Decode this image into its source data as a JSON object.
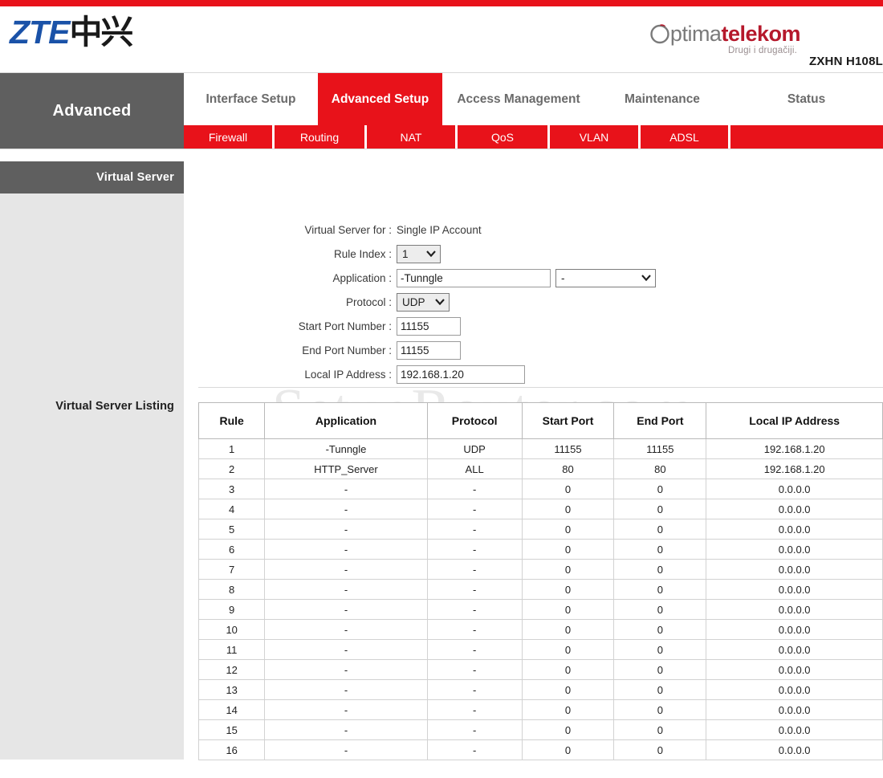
{
  "branding": {
    "zte_latin": "ZTE",
    "zte_cjk": "中兴",
    "optima_o": "O",
    "optima_ptima": "ptima",
    "optima_telekom": "telekom",
    "optima_tagline": "Drugi i drugačiji.",
    "model": "ZXHN H108L",
    "accent_red": "#e8121a",
    "dark_gray": "#5f5f5f"
  },
  "watermark": {
    "text": "SetupRouter.com"
  },
  "nav": {
    "section_title": "Advanced",
    "tabs": [
      {
        "label": "Interface Setup",
        "active": false
      },
      {
        "label": "Advanced Setup",
        "active": true
      },
      {
        "label": "Access Management",
        "active": false
      },
      {
        "label": "Maintenance",
        "active": false
      },
      {
        "label": "Status",
        "active": false
      }
    ],
    "subnav": [
      {
        "label": "Firewall"
      },
      {
        "label": "Routing"
      },
      {
        "label": "NAT"
      },
      {
        "label": "QoS"
      },
      {
        "label": "VLAN"
      },
      {
        "label": "ADSL"
      }
    ]
  },
  "sidebar": {
    "section_header": "Virtual Server",
    "listing_label": "Virtual Server Listing"
  },
  "form": {
    "virtual_server_for_label": "Virtual Server for :",
    "virtual_server_for_value": "Single IP Account",
    "rule_index_label": "Rule Index :",
    "rule_index_value": "1",
    "application_label": "Application :",
    "application_value": "-Tunngle",
    "application_select_value": "-",
    "protocol_label": "Protocol :",
    "protocol_value": "UDP",
    "start_port_label": "Start Port Number :",
    "start_port_value": "11155",
    "end_port_label": "End Port Number :",
    "end_port_value": "11155",
    "local_ip_label": "Local IP Address :",
    "local_ip_value": "192.168.1.20"
  },
  "table": {
    "headers": [
      "Rule",
      "Application",
      "Protocol",
      "Start Port",
      "End Port",
      "Local IP Address"
    ],
    "rows": [
      [
        "1",
        "-Tunngle",
        "UDP",
        "11155",
        "11155",
        "192.168.1.20"
      ],
      [
        "2",
        "HTTP_Server",
        "ALL",
        "80",
        "80",
        "192.168.1.20"
      ],
      [
        "3",
        "-",
        "-",
        "0",
        "0",
        "0.0.0.0"
      ],
      [
        "4",
        "-",
        "-",
        "0",
        "0",
        "0.0.0.0"
      ],
      [
        "5",
        "-",
        "-",
        "0",
        "0",
        "0.0.0.0"
      ],
      [
        "6",
        "-",
        "-",
        "0",
        "0",
        "0.0.0.0"
      ],
      [
        "7",
        "-",
        "-",
        "0",
        "0",
        "0.0.0.0"
      ],
      [
        "8",
        "-",
        "-",
        "0",
        "0",
        "0.0.0.0"
      ],
      [
        "9",
        "-",
        "-",
        "0",
        "0",
        "0.0.0.0"
      ],
      [
        "10",
        "-",
        "-",
        "0",
        "0",
        "0.0.0.0"
      ],
      [
        "11",
        "-",
        "-",
        "0",
        "0",
        "0.0.0.0"
      ],
      [
        "12",
        "-",
        "-",
        "0",
        "0",
        "0.0.0.0"
      ],
      [
        "13",
        "-",
        "-",
        "0",
        "0",
        "0.0.0.0"
      ],
      [
        "14",
        "-",
        "-",
        "0",
        "0",
        "0.0.0.0"
      ],
      [
        "15",
        "-",
        "-",
        "0",
        "0",
        "0.0.0.0"
      ],
      [
        "16",
        "-",
        "-",
        "0",
        "0",
        "0.0.0.0"
      ]
    ]
  }
}
